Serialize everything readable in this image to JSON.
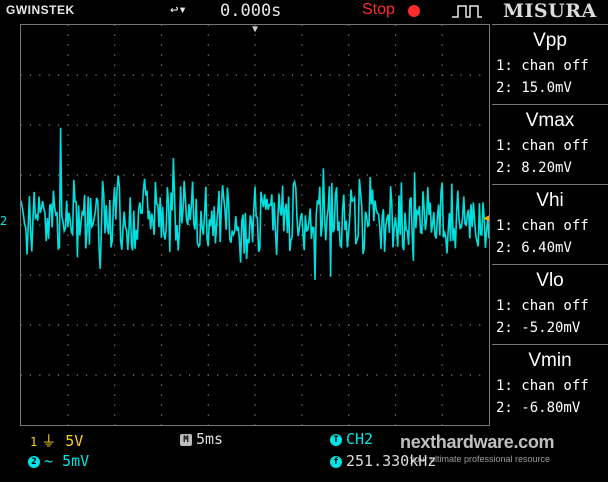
{
  "header": {
    "brand": "GWINSTEK",
    "trigger_icon_glyph": "↩▾",
    "time_offset": "0.000s",
    "run_state": "Stop",
    "measure_label": "MISURA"
  },
  "colors": {
    "ch1": "#ffd21a",
    "ch2": "#00e5e5",
    "stop": "#ff2a2a",
    "grid": "#8a8a8a",
    "trace": "#00e0e0"
  },
  "channel_marker": "2",
  "measurements": [
    {
      "title": "Vpp",
      "row1": "1: chan off",
      "row2": "2: 15.0mV"
    },
    {
      "title": "Vmax",
      "row1": "1: chan off",
      "row2": "2: 8.20mV"
    },
    {
      "title": "Vhi",
      "row1": "1: chan off",
      "row2": "2: 6.40mV"
    },
    {
      "title": "Vlo",
      "row1": "1: chan off",
      "row2": "2: -5.20mV"
    },
    {
      "title": "Vmin",
      "row1": "1: chan off",
      "row2": "2: -6.80mV"
    }
  ],
  "footer": {
    "ch1_badge": "1",
    "ch1_coupling_glyph": "⏚",
    "ch1_scale": "5V",
    "ch2_badge": "2",
    "ch2_coupling_glyph": "~",
    "ch2_scale": "5mV",
    "timebase_badge": "M",
    "timebase": "5ms",
    "trigger_badge": "T",
    "trigger_source": "CH2",
    "freq_badge": "f",
    "frequency": "251.330kHz"
  },
  "watermark": {
    "text": "nexthardware.com",
    "sub": "your ultimate professional resource"
  }
}
